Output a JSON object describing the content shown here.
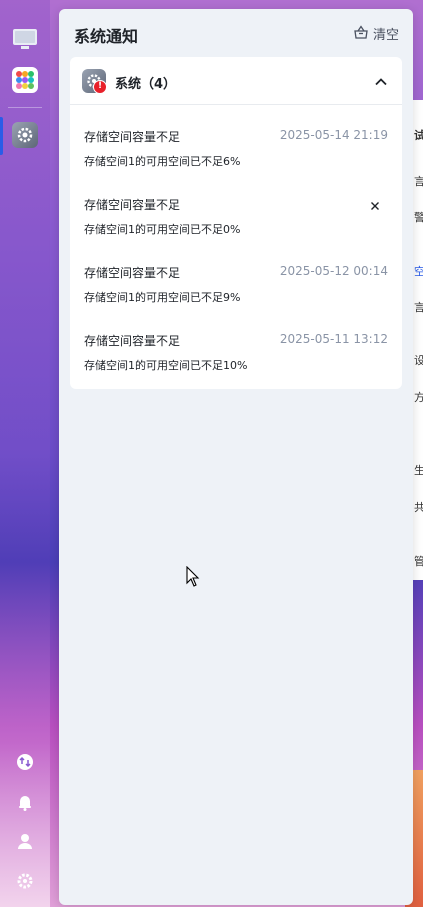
{
  "panel": {
    "title": "系统通知",
    "clear_label": "清空"
  },
  "group": {
    "title": "系统（4）",
    "badge": "!"
  },
  "notifications": [
    {
      "title": "存储空间容量不足",
      "time": "2025-05-14 21:19",
      "desc": "存储空间1的可用空间已不足6%"
    },
    {
      "title": "存储空间容量不足",
      "time": "",
      "desc": "存储空间1的可用空间已不足0%"
    },
    {
      "title": "存储空间容量不足",
      "time": "2025-05-12 00:14",
      "desc": "存储空间1的可用空间已不足9%"
    },
    {
      "title": "存储空间容量不足",
      "time": "2025-05-11 13:12",
      "desc": "存储空间1的可用空间已不足10%"
    }
  ],
  "background_peek": [
    "试",
    "言",
    "警",
    "空",
    "言",
    "设",
    "方",
    "生",
    "共",
    "管"
  ],
  "colors": {
    "accent": "#2a5ce8",
    "badge_red": "#e8202a",
    "panel_bg": "#eef2f7",
    "time_gray": "#8a94a6"
  },
  "icons": {
    "dock": [
      "monitor-icon",
      "app-grid-icon",
      "settings-icon",
      "transfer-icon",
      "bell-icon",
      "user-icon",
      "gear-icon"
    ],
    "panel": [
      "clear-basket-icon",
      "chevron-up-icon",
      "close-icon"
    ]
  }
}
